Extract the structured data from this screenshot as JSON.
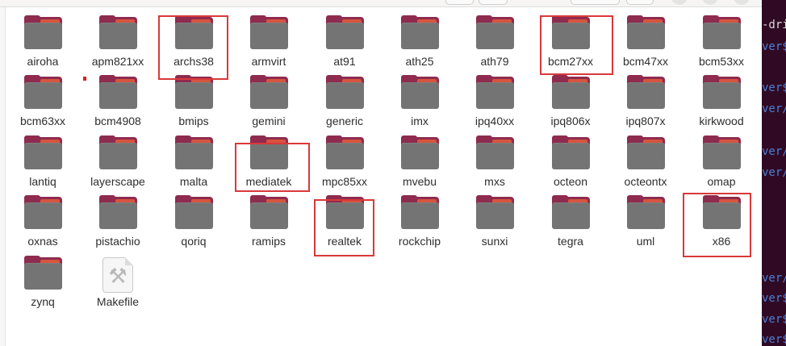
{
  "colors": {
    "folder_body": "#747474",
    "folder_back": "#8e2b4e",
    "folder_lip": "#d7543e",
    "selection_marker": "#d9393a",
    "terminal_bg": "#300a24",
    "terminal_text_white": "#d8d8d8",
    "terminal_text_blue": "#4b7fd4"
  },
  "folders": {
    "airoha": "airoha",
    "apm821xx": "apm821xx",
    "archs38": "archs38",
    "armvirt": "armvirt",
    "at91": "at91",
    "ath25": "ath25",
    "ath79": "ath79",
    "bcm27xx": "bcm27xx",
    "bcm47xx": "bcm47xx",
    "bcm53xx": "bcm53xx",
    "bcm63xx": "bcm63xx",
    "bcm4908": "bcm4908",
    "bmips": "bmips",
    "gemini": "gemini",
    "generic": "generic",
    "imx": "imx",
    "ipq40xx": "ipq40xx",
    "ipq806x": "ipq806x",
    "ipq807x": "ipq807x",
    "kirkwood": "kirkwood",
    "lantiq": "lantiq",
    "layerscape": "layerscape",
    "malta": "malta",
    "mediatek": "mediatek",
    "mpc85xx": "mpc85xx",
    "mvebu": "mvebu",
    "mxs": "mxs",
    "octeon": "octeon",
    "octeontx": "octeontx",
    "omap": "omap",
    "oxnas": "oxnas",
    "pistachio": "pistachio",
    "qoriq": "qoriq",
    "ramips": "ramips",
    "realtek": "realtek",
    "rockchip": "rockchip",
    "sunxi": "sunxi",
    "tegra": "tegra",
    "uml": "uml",
    "x86": "x86",
    "zynq": "zynq"
  },
  "files": {
    "makefile": "Makefile"
  },
  "terminal": {
    "line1": "-dri",
    "line2": "ver$",
    "line3": "ver$",
    "line4": "ver/",
    "line5": "ver/",
    "line6": "ver/",
    "line7": "ver/",
    "line8": "ver$",
    "line9": "ver$",
    "line10": "ver$"
  }
}
